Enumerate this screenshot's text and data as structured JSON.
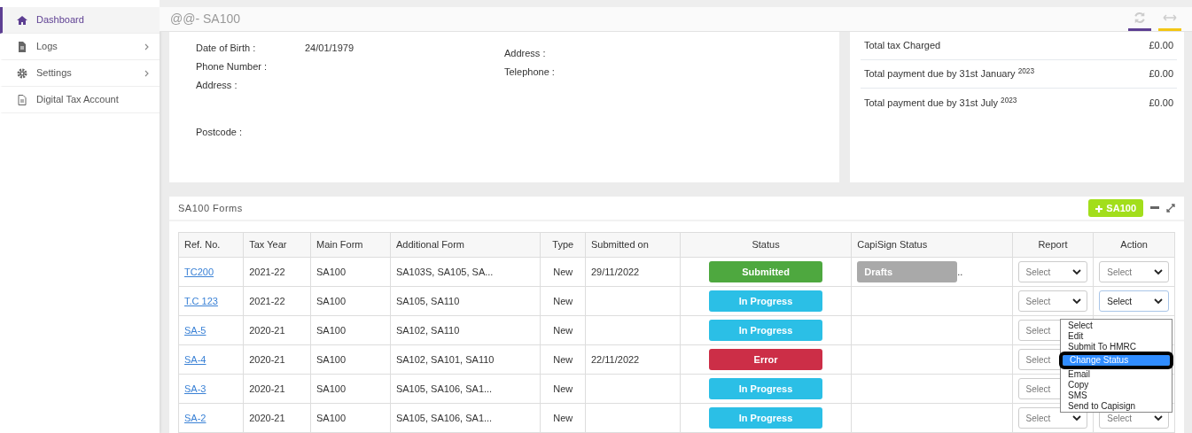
{
  "sidebar": {
    "items": [
      {
        "label": "Dashboard",
        "selected": true,
        "has_submenu": false
      },
      {
        "label": "Logs",
        "selected": false,
        "has_submenu": true
      },
      {
        "label": "Settings",
        "selected": false,
        "has_submenu": true
      },
      {
        "label": "Digital Tax Account",
        "selected": false,
        "has_submenu": false
      }
    ]
  },
  "header": {
    "title": "@@- SA100"
  },
  "details": {
    "left": [
      {
        "label": "Date of Birth :",
        "value": "24/01/1979"
      },
      {
        "label": "Phone Number :"
      },
      {
        "label": "Address :"
      },
      {
        "label": "Postcode :"
      }
    ],
    "right": [
      {
        "label": "Address :"
      },
      {
        "label": "Telephone :"
      }
    ]
  },
  "summary": [
    {
      "label": "Total tax Charged",
      "amount": "£0.00"
    },
    {
      "label": "Total payment due by 31st January $^{2023}$",
      "amount": "£0.00"
    },
    {
      "label": "Total payment due by 31st July $^{2023}$",
      "amount": "£0.00"
    }
  ],
  "forms": {
    "title": "SA100 Forms",
    "add_button": "SA100",
    "columns": [
      "Ref. No.",
      "Tax Year",
      "Main Form",
      "Additional Form",
      "Type",
      "Submitted on",
      "Status",
      "CapiSign Status",
      "Report",
      "Action"
    ],
    "rows": [
      {
        "ref": "TC200",
        "tax_year": "2021-22",
        "main_form": "SA100",
        "additional_form": "SA103S, SA105, SA...",
        "type": "New",
        "submitted_on": "29/11/2022",
        "status": {
          "text": "Submitted",
          "color": "#4ea83f"
        },
        "capisign": {
          "text": "Drafts",
          "more": ".."
        },
        "report": "Select",
        "action": {
          "value": "Select"
        }
      },
      {
        "ref": "T.C 123",
        "tax_year": "2021-22",
        "main_form": "SA100",
        "additional_form": "SA105, SA110",
        "type": "New",
        "status": {
          "text": "In Progress",
          "color": "#2bbfe6"
        },
        "report": "Select",
        "action": {
          "value": "Select",
          "menu": [
            {
              "label": "Select",
              "highlighted": false
            },
            {
              "label": "Edit",
              "highlighted": false
            },
            {
              "label": "Submit To HMRC",
              "highlighted": false
            },
            {
              "label": "Change Status",
              "highlighted": true
            },
            {
              "label": "Email",
              "highlighted": false
            },
            {
              "label": "Copy",
              "highlighted": false
            },
            {
              "label": "SMS",
              "highlighted": false
            },
            {
              "label": "Send to Capisign",
              "highlighted": false
            }
          ]
        }
      },
      {
        "ref": "SA-5",
        "tax_year": "2020-21",
        "main_form": "SA100",
        "additional_form": "SA102, SA110",
        "type": "New",
        "status": {
          "text": "In Progress",
          "color": "#2bbfe6"
        },
        "report": "Select"
      },
      {
        "ref": "SA-4",
        "tax_year": "2020-21",
        "main_form": "SA100",
        "additional_form": "SA102, SA101, SA110",
        "type": "New",
        "submitted_on": "22/11/2022",
        "status": {
          "text": "Error",
          "color": "#cc2e47"
        },
        "report": "Select"
      },
      {
        "ref": "SA-3",
        "tax_year": "2020-21",
        "main_form": "SA100",
        "additional_form": "SA105, SA106, SA1...",
        "type": "New",
        "status": {
          "text": "In Progress",
          "color": "#2bbfe6"
        },
        "report": "Select"
      },
      {
        "ref": "SA-2",
        "tax_year": "2020-21",
        "main_form": "SA100",
        "additional_form": "SA105, SA106, SA1...",
        "type": "New",
        "status": {
          "text": "In Progress",
          "color": "#2bbfe6"
        },
        "report": "Select",
        "action": {
          "value": "Select"
        }
      }
    ]
  }
}
